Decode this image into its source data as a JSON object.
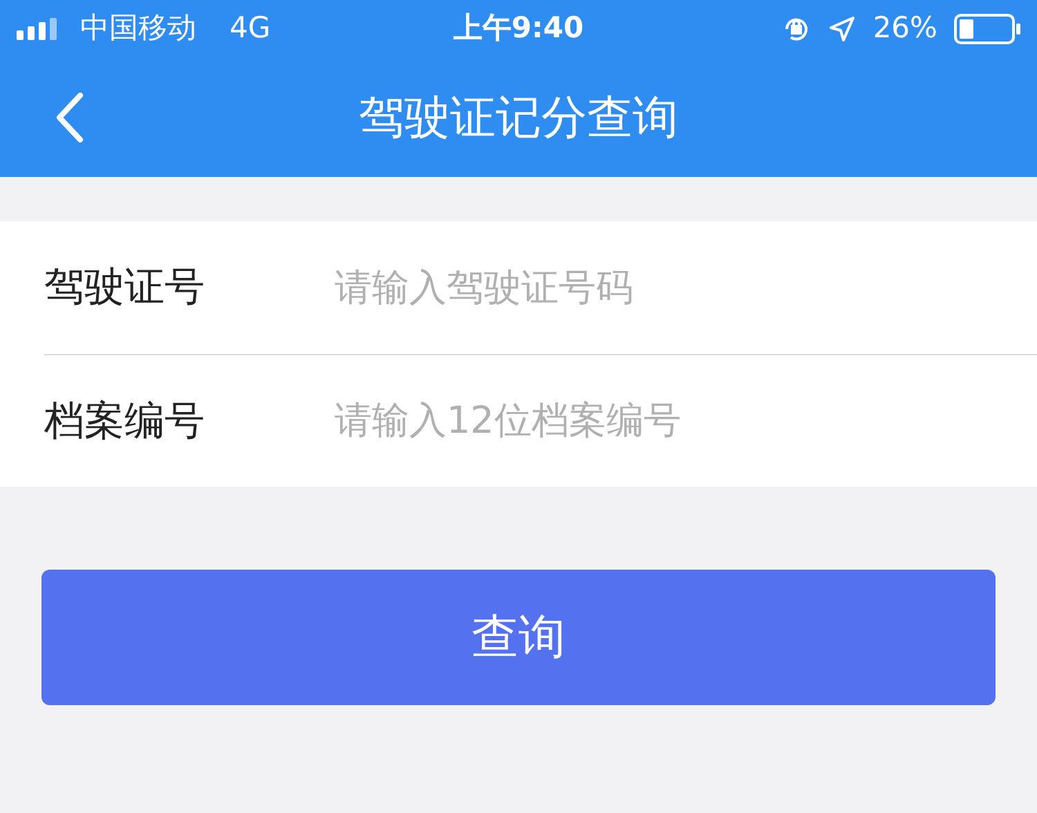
{
  "status_bar": {
    "carrier": "中国移动",
    "network": "4G",
    "time": "上午9:40",
    "battery": "26%"
  },
  "nav": {
    "title": "驾驶证记分查询"
  },
  "form": {
    "fields": [
      {
        "label": "驾驶证号",
        "placeholder": "请输入驾驶证号码"
      },
      {
        "label": "档案编号",
        "placeholder": "请输入12位档案编号"
      }
    ]
  },
  "submit_button": "查询"
}
